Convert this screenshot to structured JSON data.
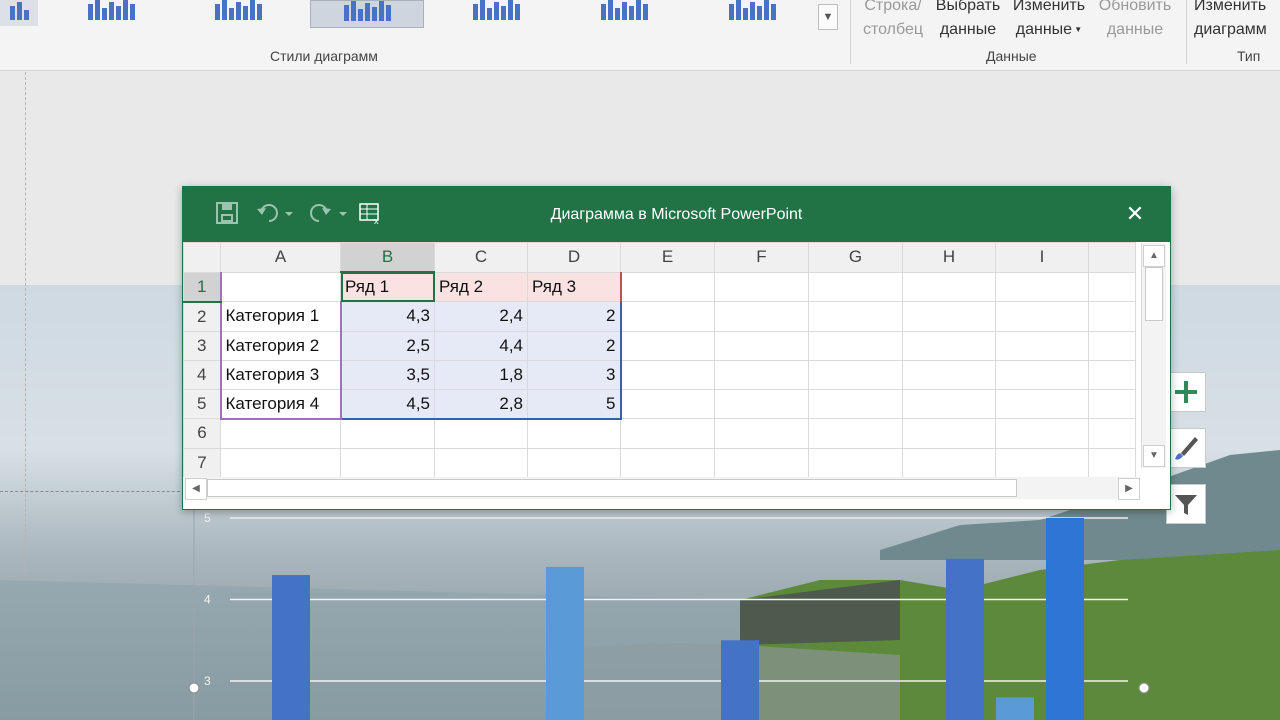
{
  "ribbon": {
    "chart_styles_label": "Стили диаграмм",
    "data_group_label": "Данные",
    "type_group_label": "Тип",
    "switch_row_col": [
      "Строка/",
      "столбец"
    ],
    "select_data": [
      "Выбрать",
      "данные"
    ],
    "edit_data": [
      "Изменить",
      "данные"
    ],
    "refresh_data": [
      "Обновить",
      "данные"
    ],
    "change_type": [
      "Изменить",
      "диаграмм"
    ],
    "accent": "#4a72c4"
  },
  "excel": {
    "title": "Диаграмма в Microsoft PowerPoint",
    "title_bar_color": "#217346",
    "columns": [
      "A",
      "B",
      "C",
      "D",
      "E",
      "F",
      "G",
      "H",
      "I"
    ],
    "rows": [
      "1",
      "2",
      "3",
      "4",
      "5",
      "6",
      "7"
    ],
    "cells": [
      [
        "",
        "Ряд 1",
        "Ряд 2",
        "Ряд 3"
      ],
      [
        "Категория 1",
        "4,3",
        "2,4",
        "2"
      ],
      [
        "Категория 2",
        "2,5",
        "4,4",
        "2"
      ],
      [
        "Категория 3",
        "3,5",
        "1,8",
        "3"
      ],
      [
        "Категория 4",
        "4,5",
        "2,8",
        "5"
      ]
    ]
  },
  "chart_data": {
    "type": "bar",
    "categories": [
      "Категория 1",
      "Категория 2",
      "Категория 3",
      "Категория 4"
    ],
    "series": [
      {
        "name": "Ряд 1",
        "values": [
          4.3,
          2.5,
          3.5,
          4.5
        ],
        "color": "#4472c4"
      },
      {
        "name": "Ряд 2",
        "values": [
          2.4,
          4.4,
          1.8,
          2.8
        ],
        "color": "#5b9bd5"
      },
      {
        "name": "Ряд 3",
        "values": [
          2,
          2,
          3,
          5
        ],
        "color": "#2e75d6"
      }
    ],
    "y_ticks": [
      "3",
      "4",
      "5"
    ],
    "ylim": [
      0,
      5
    ],
    "grid": true
  }
}
